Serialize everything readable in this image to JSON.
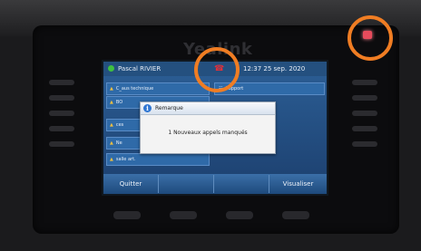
{
  "device": {
    "brand": "Yealink"
  },
  "status_bar": {
    "user": "Pascal RIVIER",
    "clock": "12:37  25 sep. 2020"
  },
  "line_keys": [
    {
      "label": "C_aus technique"
    },
    {
      "label": "BO"
    },
    {
      "label": "ces"
    },
    {
      "label": "Ne"
    },
    {
      "label": "salle art."
    }
  ],
  "line_key_right": {
    "label": "Support"
  },
  "dialog": {
    "title": "Remarque",
    "info_icon_glyph": "i",
    "message": "1 Nouveaux appels manqués"
  },
  "softkeys": [
    "Quitter",
    "",
    "",
    "Visualiser"
  ],
  "icons": {
    "presence": "presence-online-icon",
    "alert": "missed-call-alert-icon",
    "led": "message-led-icon"
  },
  "colors": {
    "highlight_circle": "#f07d23",
    "led": "#e64b5c",
    "screen_blue": "#2c5f96"
  }
}
